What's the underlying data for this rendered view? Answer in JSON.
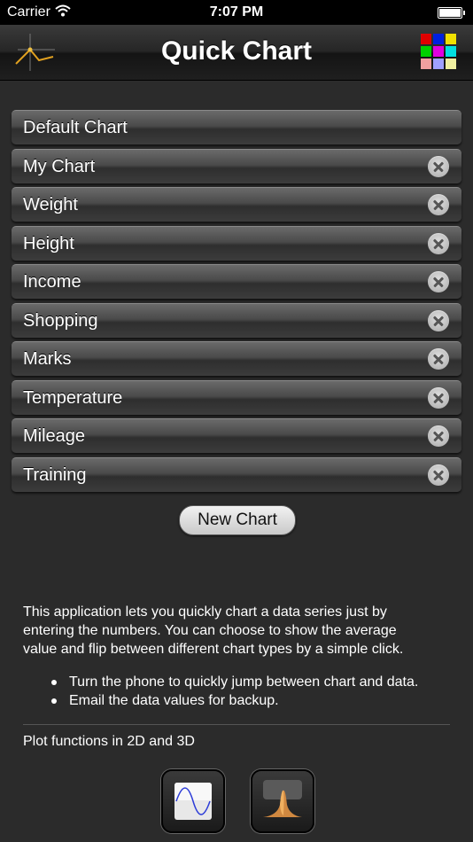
{
  "status_bar": {
    "carrier": "Carrier",
    "time": "7:07 PM"
  },
  "nav": {
    "title": "Quick Chart",
    "left_icon": "line-chart-logo-icon",
    "right_icon": "color-grid-icon",
    "color_grid": [
      "#e00000",
      "#0020e0",
      "#f0e000",
      "#00d000",
      "#e000e0",
      "#00e0e0",
      "#f0a0a0",
      "#a0a0ff",
      "#f0f0a0"
    ]
  },
  "charts": [
    {
      "label": "Default Chart",
      "deletable": false
    },
    {
      "label": "My Chart",
      "deletable": true
    },
    {
      "label": "Weight",
      "deletable": true
    },
    {
      "label": "Height",
      "deletable": true
    },
    {
      "label": "Income",
      "deletable": true
    },
    {
      "label": "Shopping",
      "deletable": true
    },
    {
      "label": "Marks",
      "deletable": true
    },
    {
      "label": "Temperature",
      "deletable": true
    },
    {
      "label": "Mileage",
      "deletable": true
    },
    {
      "label": "Training",
      "deletable": true
    }
  ],
  "new_chart_button": "New Chart",
  "info": {
    "description": "This application lets you quickly chart a data series just by entering the numbers. You can choose to show the average value and flip between different chart types by a simple click.",
    "bullets": [
      "Turn the phone to quickly jump between chart and data.",
      "Email the data values for backup."
    ],
    "plot_functions": "Plot functions in 2D and 3D"
  },
  "apps": [
    {
      "icon": "plot-2d-sine-icon"
    },
    {
      "icon": "plot-3d-peak-icon"
    }
  ]
}
